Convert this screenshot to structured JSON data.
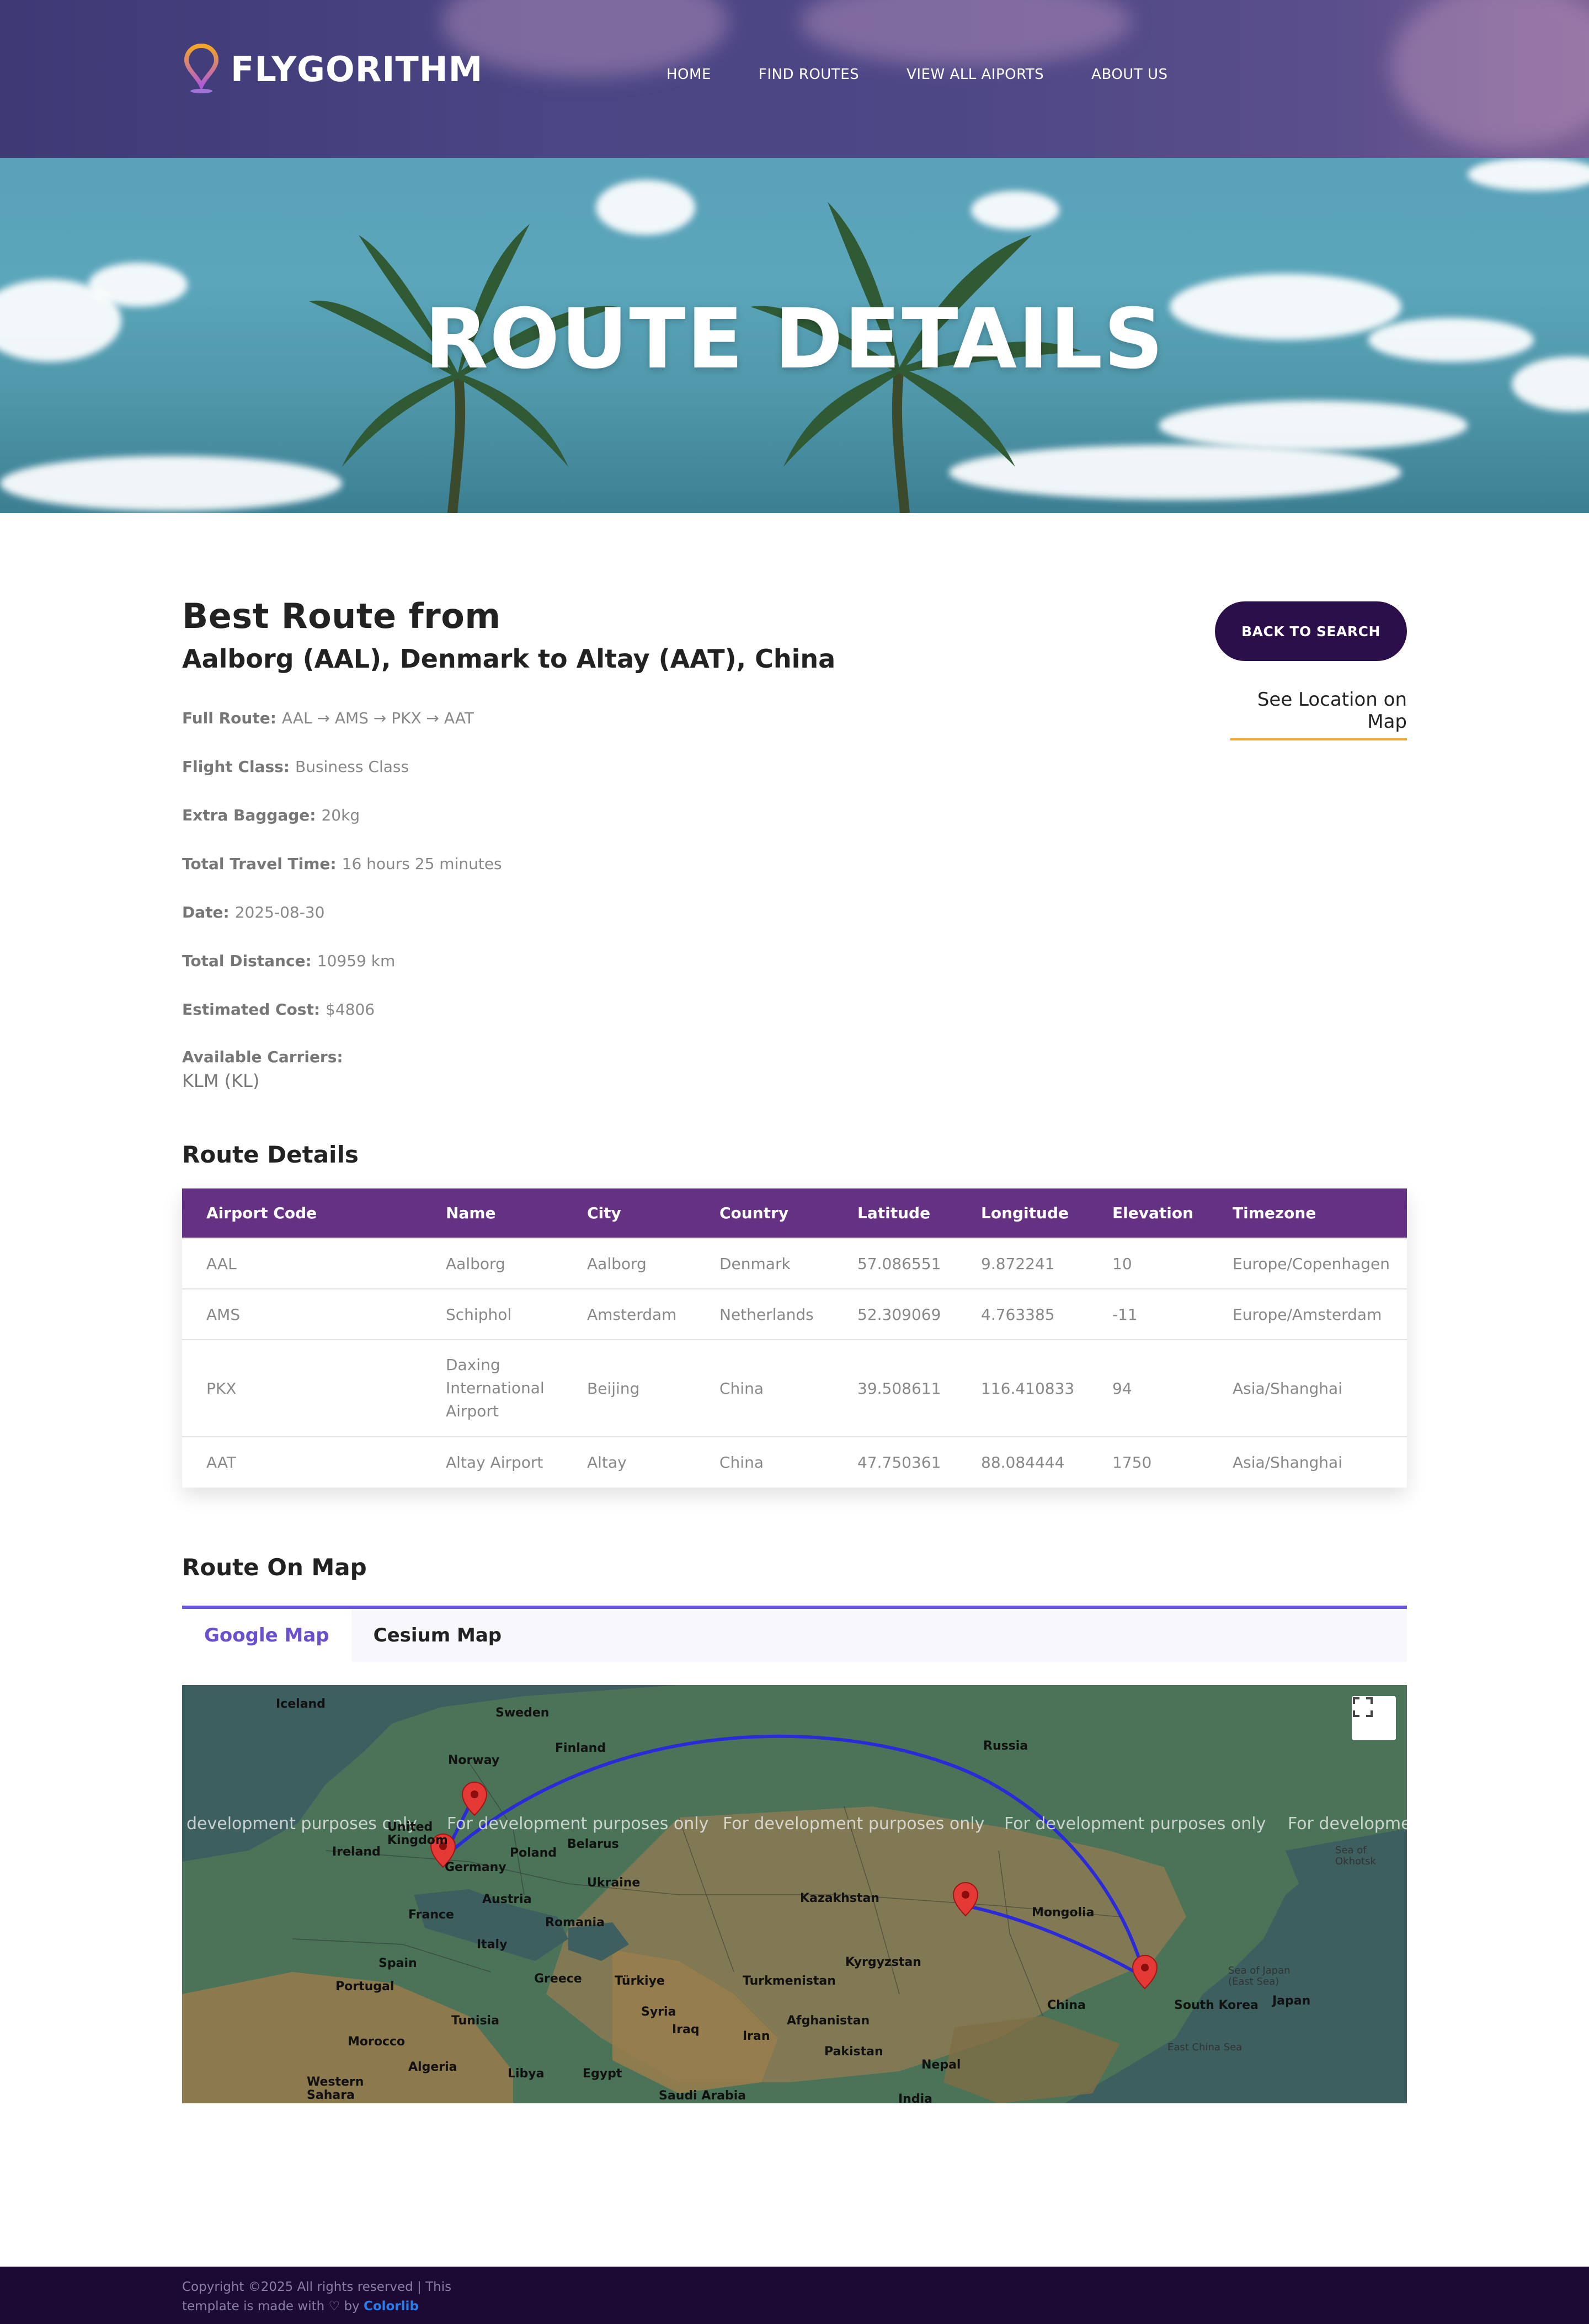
{
  "brand": {
    "name": "FLYGORITHM"
  },
  "nav": {
    "items": [
      {
        "label": "HOME"
      },
      {
        "label": "FIND ROUTES"
      },
      {
        "label": "VIEW ALL AIPORTS"
      },
      {
        "label": "ABOUT US"
      }
    ]
  },
  "hero": {
    "title": "ROUTE DETAILS"
  },
  "route": {
    "heading": "Best Route from",
    "subheading": "Aalborg (AAL), Denmark to Altay (AAT), China",
    "back_button": "BACK TO SEARCH",
    "see_map_link": "See Location on Map",
    "info": [
      {
        "label": "Full Route:",
        "value": "AAL → AMS → PKX → AAT"
      },
      {
        "label": "Flight Class:",
        "value": "Business Class"
      },
      {
        "label": "Extra Baggage:",
        "value": "20kg"
      },
      {
        "label": "Total Travel Time:",
        "value": "16 hours 25 minutes"
      },
      {
        "label": "Date:",
        "value": "2025-08-30"
      },
      {
        "label": "Total Distance:",
        "value": "10959 km"
      },
      {
        "label": "Estimated Cost:",
        "value": "$4806"
      }
    ],
    "carriers_label": "Available Carriers:",
    "carriers_value": "KLM (KL)"
  },
  "details": {
    "title": "Route Details",
    "columns": [
      "Airport Code",
      "Name",
      "City",
      "Country",
      "Latitude",
      "Longitude",
      "Elevation",
      "Timezone"
    ],
    "rows": [
      [
        "AAL",
        "Aalborg",
        "Aalborg",
        "Denmark",
        "57.086551",
        "9.872241",
        "10",
        "Europe/Copenhagen"
      ],
      [
        "AMS",
        "Schiphol",
        "Amsterdam",
        "Netherlands",
        "52.309069",
        "4.763385",
        "-11",
        "Europe/Amsterdam"
      ],
      [
        "PKX",
        "Daxing International Airport",
        "Beijing",
        "China",
        "39.508611",
        "116.410833",
        "94",
        "Asia/Shanghai"
      ],
      [
        "AAT",
        "Altay Airport",
        "Altay",
        "China",
        "47.750361",
        "88.084444",
        "1750",
        "Asia/Shanghai"
      ]
    ]
  },
  "map_section": {
    "title": "Route On Map",
    "tabs": [
      {
        "label": "Google Map",
        "active": true
      },
      {
        "label": "Cesium Map",
        "active": false
      }
    ],
    "watermark": "For development purposes only",
    "watermark_left": "development purposes only",
    "watermark_right": "For developmen",
    "labels": {
      "iceland": "Iceland",
      "sweden": "Sweden",
      "finland": "Finland",
      "norway": "Norway",
      "russia": "Russia",
      "uk": "United Kingdom",
      "ireland": "Ireland",
      "belarus": "Belarus",
      "poland": "Poland",
      "germany": "Germany",
      "ukraine": "Ukraine",
      "austria": "Austria",
      "france": "France",
      "romania": "Romania",
      "italy": "Italy",
      "kazakhstan": "Kazakhstan",
      "mongolia": "Mongolia",
      "spain": "Spain",
      "portugal": "Portugal",
      "greece": "Greece",
      "turkiye": "Türkiye",
      "turkmenistan": "Turkmenistan",
      "kyrgyzstan": "Kyrgyzstan",
      "tunisia": "Tunisia",
      "syria": "Syria",
      "iraq": "Iraq",
      "afghanistan": "Afghanistan",
      "iran": "Iran",
      "china": "China",
      "south_korea": "South Korea",
      "japan": "Japan",
      "morocco": "Morocco",
      "algeria": "Algeria",
      "libya": "Libya",
      "egypt": "Egypt",
      "pakistan": "Pakistan",
      "nepal": "Nepal",
      "western_sahara": "Western Sahara",
      "saudi_arabia": "Saudi Arabia",
      "india": "India",
      "sea_of_okhotsk": "Sea of Okhotsk",
      "sea_of_japan": "Sea of Japan (East Sea)",
      "east_china_sea": "East China Sea"
    }
  },
  "footer": {
    "text_1": "Copyright ©2025 All rights reserved | This",
    "text_2": "template is made with",
    "text_3": "by",
    "link": "Colorlib"
  },
  "colors": {
    "nav_bg": "#4a4584",
    "accent_purple": "#653183",
    "button_dark": "#2a0f4a",
    "tab_active": "#6a4fcf",
    "underline_orange": "#f2a72e",
    "route_line": "#2a2ad8",
    "marker_red": "#e53935",
    "footer_bg": "#1c0a34"
  }
}
